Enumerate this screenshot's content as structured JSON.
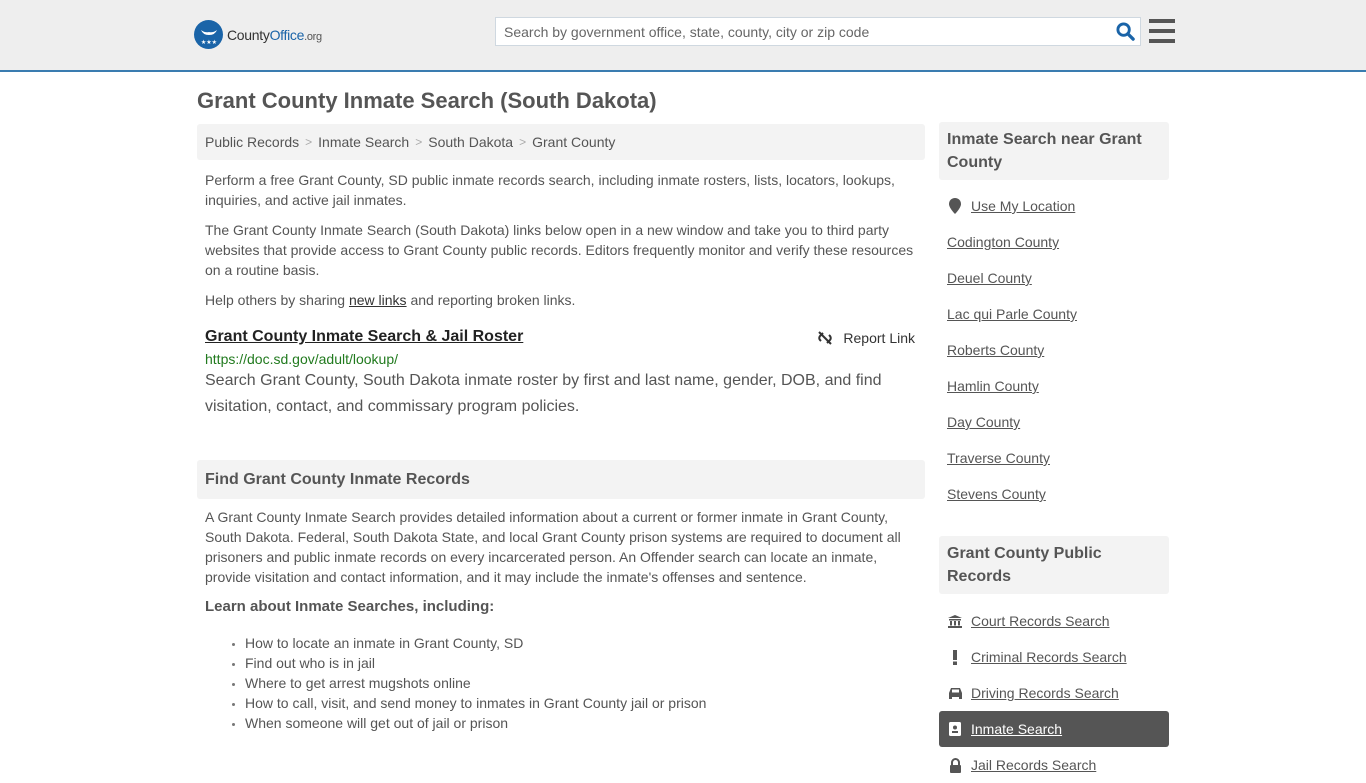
{
  "header": {
    "logo": {
      "name_part1": "County",
      "name_part2": "Office",
      "suffix": ".org"
    },
    "search": {
      "placeholder": "Search by government office, state, county, city or zip code",
      "value": ""
    },
    "brand_color": "#1a64a8"
  },
  "page": {
    "title": "Grant County Inmate Search (South Dakota)"
  },
  "breadcrumb": [
    {
      "label": "Public Records"
    },
    {
      "label": "Inmate Search"
    },
    {
      "label": "South Dakota"
    },
    {
      "label": "Grant County"
    }
  ],
  "intro": {
    "p1": "Perform a free Grant County, SD public inmate records search, including inmate rosters, lists, locators, lookups, inquiries, and active jail inmates.",
    "p2": "The Grant County Inmate Search (South Dakota) links below open in a new window and take you to third party websites that provide access to Grant County public records. Editors frequently monitor and verify these resources on a routine basis.",
    "p3_before": "Help others by sharing ",
    "p3_link": "new links",
    "p3_after": " and reporting broken links."
  },
  "resource": {
    "title": "Grant County Inmate Search & Jail Roster",
    "url": "https://doc.sd.gov/adult/lookup/",
    "description": "Search Grant County, South Dakota inmate roster by first and last name, gender, DOB, and find visitation, contact, and commissary program policies.",
    "report_label": "Report Link"
  },
  "records_section": {
    "heading": "Find Grant County Inmate Records",
    "body": "A Grant County Inmate Search provides detailed information about a current or former inmate in Grant County, South Dakota. Federal, South Dakota State, and local Grant County prison systems are required to document all prisoners and public inmate records on every incarcerated person. An Offender search can locate an inmate, provide visitation and contact information, and it may include the inmate's offenses and sentence.",
    "learn_heading": "Learn about Inmate Searches, including:",
    "bullets": [
      "How to locate an inmate in Grant County, SD",
      "Find out who is in jail",
      "Where to get arrest mugshots online",
      "How to call, visit, and send money to inmates in Grant County jail or prison",
      "When someone will get out of jail or prison"
    ]
  },
  "sidebar": {
    "nearby": {
      "heading": "Inmate Search near Grant County",
      "location_label": "Use My Location",
      "counties": [
        "Codington County",
        "Deuel County",
        "Lac qui Parle County",
        "Roberts County",
        "Hamlin County",
        "Day County",
        "Traverse County",
        "Stevens County"
      ]
    },
    "public_records": {
      "heading": "Grant County Public Records",
      "items": [
        {
          "label": "Court Records Search",
          "icon": "courthouse-icon"
        },
        {
          "label": "Criminal Records Search",
          "icon": "exclamation-icon"
        },
        {
          "label": "Driving Records Search",
          "icon": "car-icon"
        },
        {
          "label": "Inmate Search",
          "icon": "id-badge-icon",
          "active": true
        },
        {
          "label": "Jail Records Search",
          "icon": "lock-icon"
        }
      ]
    }
  }
}
